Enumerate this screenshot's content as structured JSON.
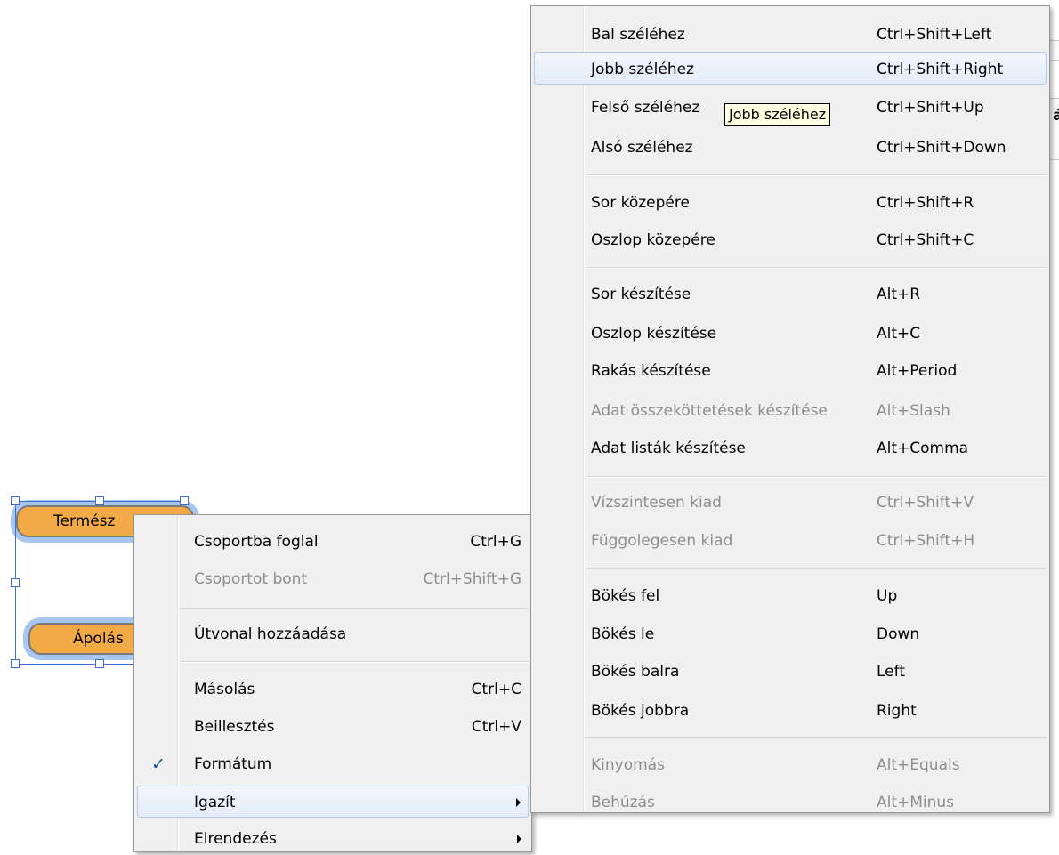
{
  "canvas": {
    "nodes": [
      {
        "label": "Termész"
      },
      {
        "label": "Ápolás"
      }
    ],
    "background_fragment": "á"
  },
  "context_menu": {
    "items": [
      {
        "label": "Csoportba foglal",
        "shortcut": "Ctrl+G",
        "enabled": true
      },
      {
        "label": "Csoportot bont",
        "shortcut": "Ctrl+Shift+G",
        "enabled": false
      },
      {
        "label": "Útvonal hozzáadása",
        "shortcut": "",
        "enabled": true
      },
      {
        "label": "Másolás",
        "shortcut": "Ctrl+C",
        "enabled": true
      },
      {
        "label": "Beillesztés",
        "shortcut": "Ctrl+V",
        "enabled": true
      },
      {
        "label": "Formátum",
        "shortcut": "",
        "enabled": true,
        "checked": true,
        "check_glyph": "✓"
      },
      {
        "label": "Igazít",
        "shortcut": "",
        "enabled": true,
        "submenu": true,
        "highlighted": true
      },
      {
        "label": "Elrendezés",
        "shortcut": "",
        "enabled": true,
        "submenu": true
      }
    ]
  },
  "align_submenu": {
    "items": [
      {
        "label": "Bal széléhez",
        "shortcut": "Ctrl+Shift+Left",
        "enabled": true
      },
      {
        "label": "Jobb széléhez",
        "shortcut": "Ctrl+Shift+Right",
        "enabled": true,
        "highlighted": true
      },
      {
        "label": "Felső széléhez",
        "shortcut": "Ctrl+Shift+Up",
        "enabled": true
      },
      {
        "label": "Alsó széléhez",
        "shortcut": "Ctrl+Shift+Down",
        "enabled": true
      },
      {
        "label": "Sor közepére",
        "shortcut": "Ctrl+Shift+R",
        "enabled": true
      },
      {
        "label": "Oszlop közepére",
        "shortcut": "Ctrl+Shift+C",
        "enabled": true
      },
      {
        "label": "Sor készítése",
        "shortcut": "Alt+R",
        "enabled": true
      },
      {
        "label": "Oszlop készítése",
        "shortcut": "Alt+C",
        "enabled": true
      },
      {
        "label": "Rakás készítése",
        "shortcut": "Alt+Period",
        "enabled": true
      },
      {
        "label": "Adat összeköttetések készítése",
        "shortcut": "Alt+Slash",
        "enabled": false
      },
      {
        "label": "Adat listák készítése",
        "shortcut": "Alt+Comma",
        "enabled": true
      },
      {
        "label": "Vízszintesen kiad",
        "shortcut": "Ctrl+Shift+V",
        "enabled": false
      },
      {
        "label": "Függolegesen kiad",
        "shortcut": "Ctrl+Shift+H",
        "enabled": false
      },
      {
        "label": "Bökés fel",
        "shortcut": "Up",
        "enabled": true
      },
      {
        "label": "Bökés le",
        "shortcut": "Down",
        "enabled": true
      },
      {
        "label": "Bökés balra",
        "shortcut": "Left",
        "enabled": true
      },
      {
        "label": "Bökés jobbra",
        "shortcut": "Right",
        "enabled": true
      },
      {
        "label": "Kinyomás",
        "shortcut": "Alt+Equals",
        "enabled": false
      },
      {
        "label": "Behúzás",
        "shortcut": "Alt+Minus",
        "enabled": false
      }
    ]
  },
  "tooltip": {
    "text": "Jobb széléhez"
  },
  "colors": {
    "node_fill": "#f2aa46",
    "node_glow": "#a8c6ef",
    "selection": "#3a6fd4",
    "menu_bg": "#f0f0f0",
    "highlight_border": "#aecbf1",
    "disabled_text": "#8d8d8d",
    "tooltip_bg": "#ffffe1"
  }
}
